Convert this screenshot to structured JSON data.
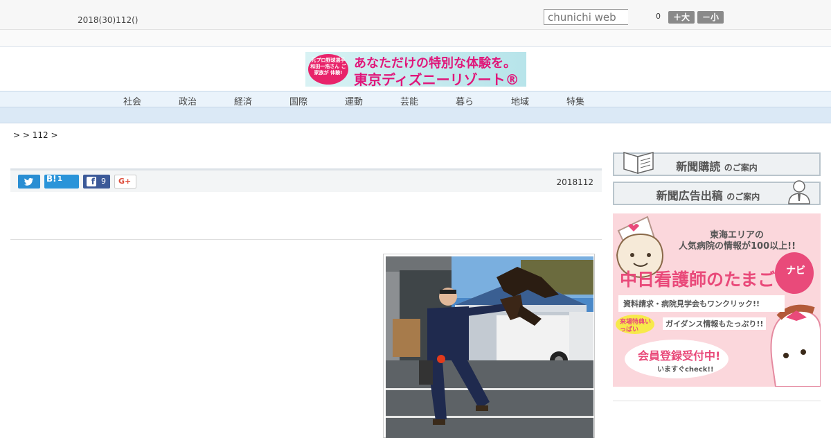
{
  "header": {
    "date": "2018(30)112()",
    "search_placeholder": "chunichi web",
    "font_size_count": "0",
    "font_bigger_label": "＋大",
    "font_smaller_label": "－小"
  },
  "banner": {
    "badge_text": "元プロ野球選手 和田一浩さん ご家族が 体験!",
    "line1": "あなただけの特別な体験を。",
    "line2": "東京ディズニーリゾート®"
  },
  "nav": {
    "items": [
      "社会",
      "政治",
      "経済",
      "国際",
      "運動",
      "芸能",
      "暮ら",
      "地域",
      "特集"
    ]
  },
  "breadcrumb": ">  > 112 >",
  "share": {
    "hatena_label": "B!",
    "hatena_count": "1",
    "facebook_count": "9",
    "gplus_label": "G+",
    "date": "2018112"
  },
  "sidebar": {
    "subscribe_main": "新聞購読",
    "subscribe_suffix": "のご案内",
    "advert_main": "新聞広告出稿",
    "advert_suffix": "のご案内"
  },
  "ad_nurse": {
    "line1": "東海エリアの",
    "line2": "人気病院の情報が100以上!!",
    "title": "中日看護師のたまご",
    "navi": "ナビ",
    "promo1": "資料請求・病院見学会もワンクリック!!",
    "badge": "来場特典いっぱい",
    "promo2": "ガイダンス情報もたっぷり!!",
    "cta": "会員登録受付中!",
    "cta_sub": "いますぐcheck!!"
  },
  "colors": {
    "nav_bg": "#eaf3fb",
    "twitter": "#2a8ed3",
    "hatena": "#2a94d9",
    "facebook": "#3b5998",
    "ad_pink": "#fbd7dc",
    "ad_title": "#e94a7a"
  }
}
